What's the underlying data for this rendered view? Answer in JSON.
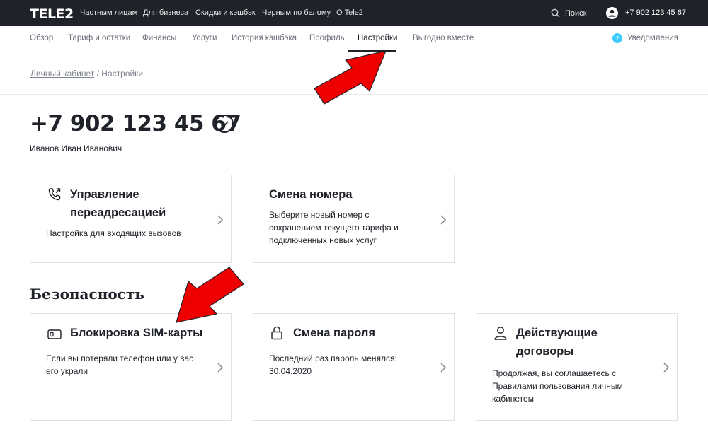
{
  "topbar": {
    "logo": "TELE2",
    "nav": [
      "Частным лицам",
      "Для бизнеса",
      "Скидки и кэшбэк",
      "Черным по белому",
      "О Tele2"
    ],
    "search_label": "Поиск",
    "user_phone": "+7 902 123 45 67"
  },
  "subnav": {
    "items": [
      "Обзор",
      "Тариф и остатки",
      "Финансы",
      "Услуги",
      "История кэшбэка",
      "Профиль",
      "Настройки",
      "Выгодно вместе"
    ],
    "active": "Настройки",
    "notifications_count": "2",
    "notifications_label": "Уведомления"
  },
  "breadcrumb": {
    "root": "Личный кабинет",
    "separator": " / ",
    "current": "Настройки"
  },
  "account": {
    "phone": "+7 902 123 45 67",
    "owner": "Иванов Иван Иванович"
  },
  "cards_top": [
    {
      "title_line1": "Управление",
      "title_line2": "переадресацией",
      "desc": [
        "Настройка для входящих вызовов"
      ],
      "icon": "phone-forward-icon"
    },
    {
      "title_line1": "Смена номера",
      "desc": [
        "Выберите новый номер с",
        "сохранением текущего тарифа и",
        "подключенных новых услуг"
      ]
    }
  ],
  "security": {
    "title": "Безопасность",
    "cards": [
      {
        "title_line1": "Блокировка SIM-карты",
        "desc": [
          "Если вы потеряли телефон или у вас",
          "его украли"
        ],
        "icon": "sim-card-icon"
      },
      {
        "title_line1": "Смена пароля",
        "desc": [
          "Последний раз пароль менялся:",
          "30.04.2020"
        ],
        "icon": "lock-icon"
      },
      {
        "title_line1": "Действующие",
        "title_line2": "договоры",
        "desc": [
          "Продолжая, вы соглашаетесь с",
          "Правилами пользования личным",
          "кабинетом"
        ],
        "icon": "user-icon"
      }
    ]
  },
  "colors": {
    "topbar_bg": "#1f2229",
    "annotation_arrow": "#ee0000",
    "notif_badge": "#3fcbff"
  }
}
